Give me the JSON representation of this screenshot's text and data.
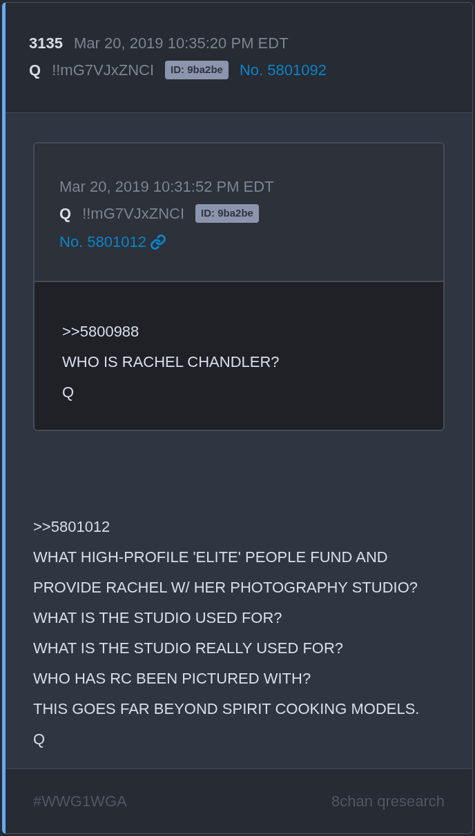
{
  "post": {
    "number": "3135",
    "date": "Mar 20, 2019 10:35:20 PM EDT",
    "name": "Q",
    "tripcode": "!!mG7VJxZNCI",
    "id_badge": "ID: 9ba2be",
    "post_link": "No. 5801092"
  },
  "quote": {
    "date": "Mar 20, 2019 10:31:52 PM EDT",
    "name": "Q",
    "tripcode": "!!mG7VJxZNCI",
    "id_badge": "ID: 9ba2be",
    "post_link": "No. 5801012",
    "lines": [
      ">>5800988",
      "WHO IS RACHEL CHANDLER?",
      "Q"
    ]
  },
  "body_lines": [
    ">>5801012",
    "WHAT HIGH-PROFILE 'ELITE' PEOPLE FUND AND PROVIDE RACHEL W/ HER PHOTOGRAPHY STUDIO?",
    "WHAT IS THE STUDIO USED FOR?",
    "WHAT IS THE STUDIO REALLY USED FOR?",
    "WHO HAS RC BEEN PICTURED WITH?",
    "THIS GOES FAR BEYOND SPIRIT COOKING MODELS.",
    "Q"
  ],
  "footer": {
    "hashtag": "#WWG1WGA",
    "source": "8chan qresearch"
  }
}
